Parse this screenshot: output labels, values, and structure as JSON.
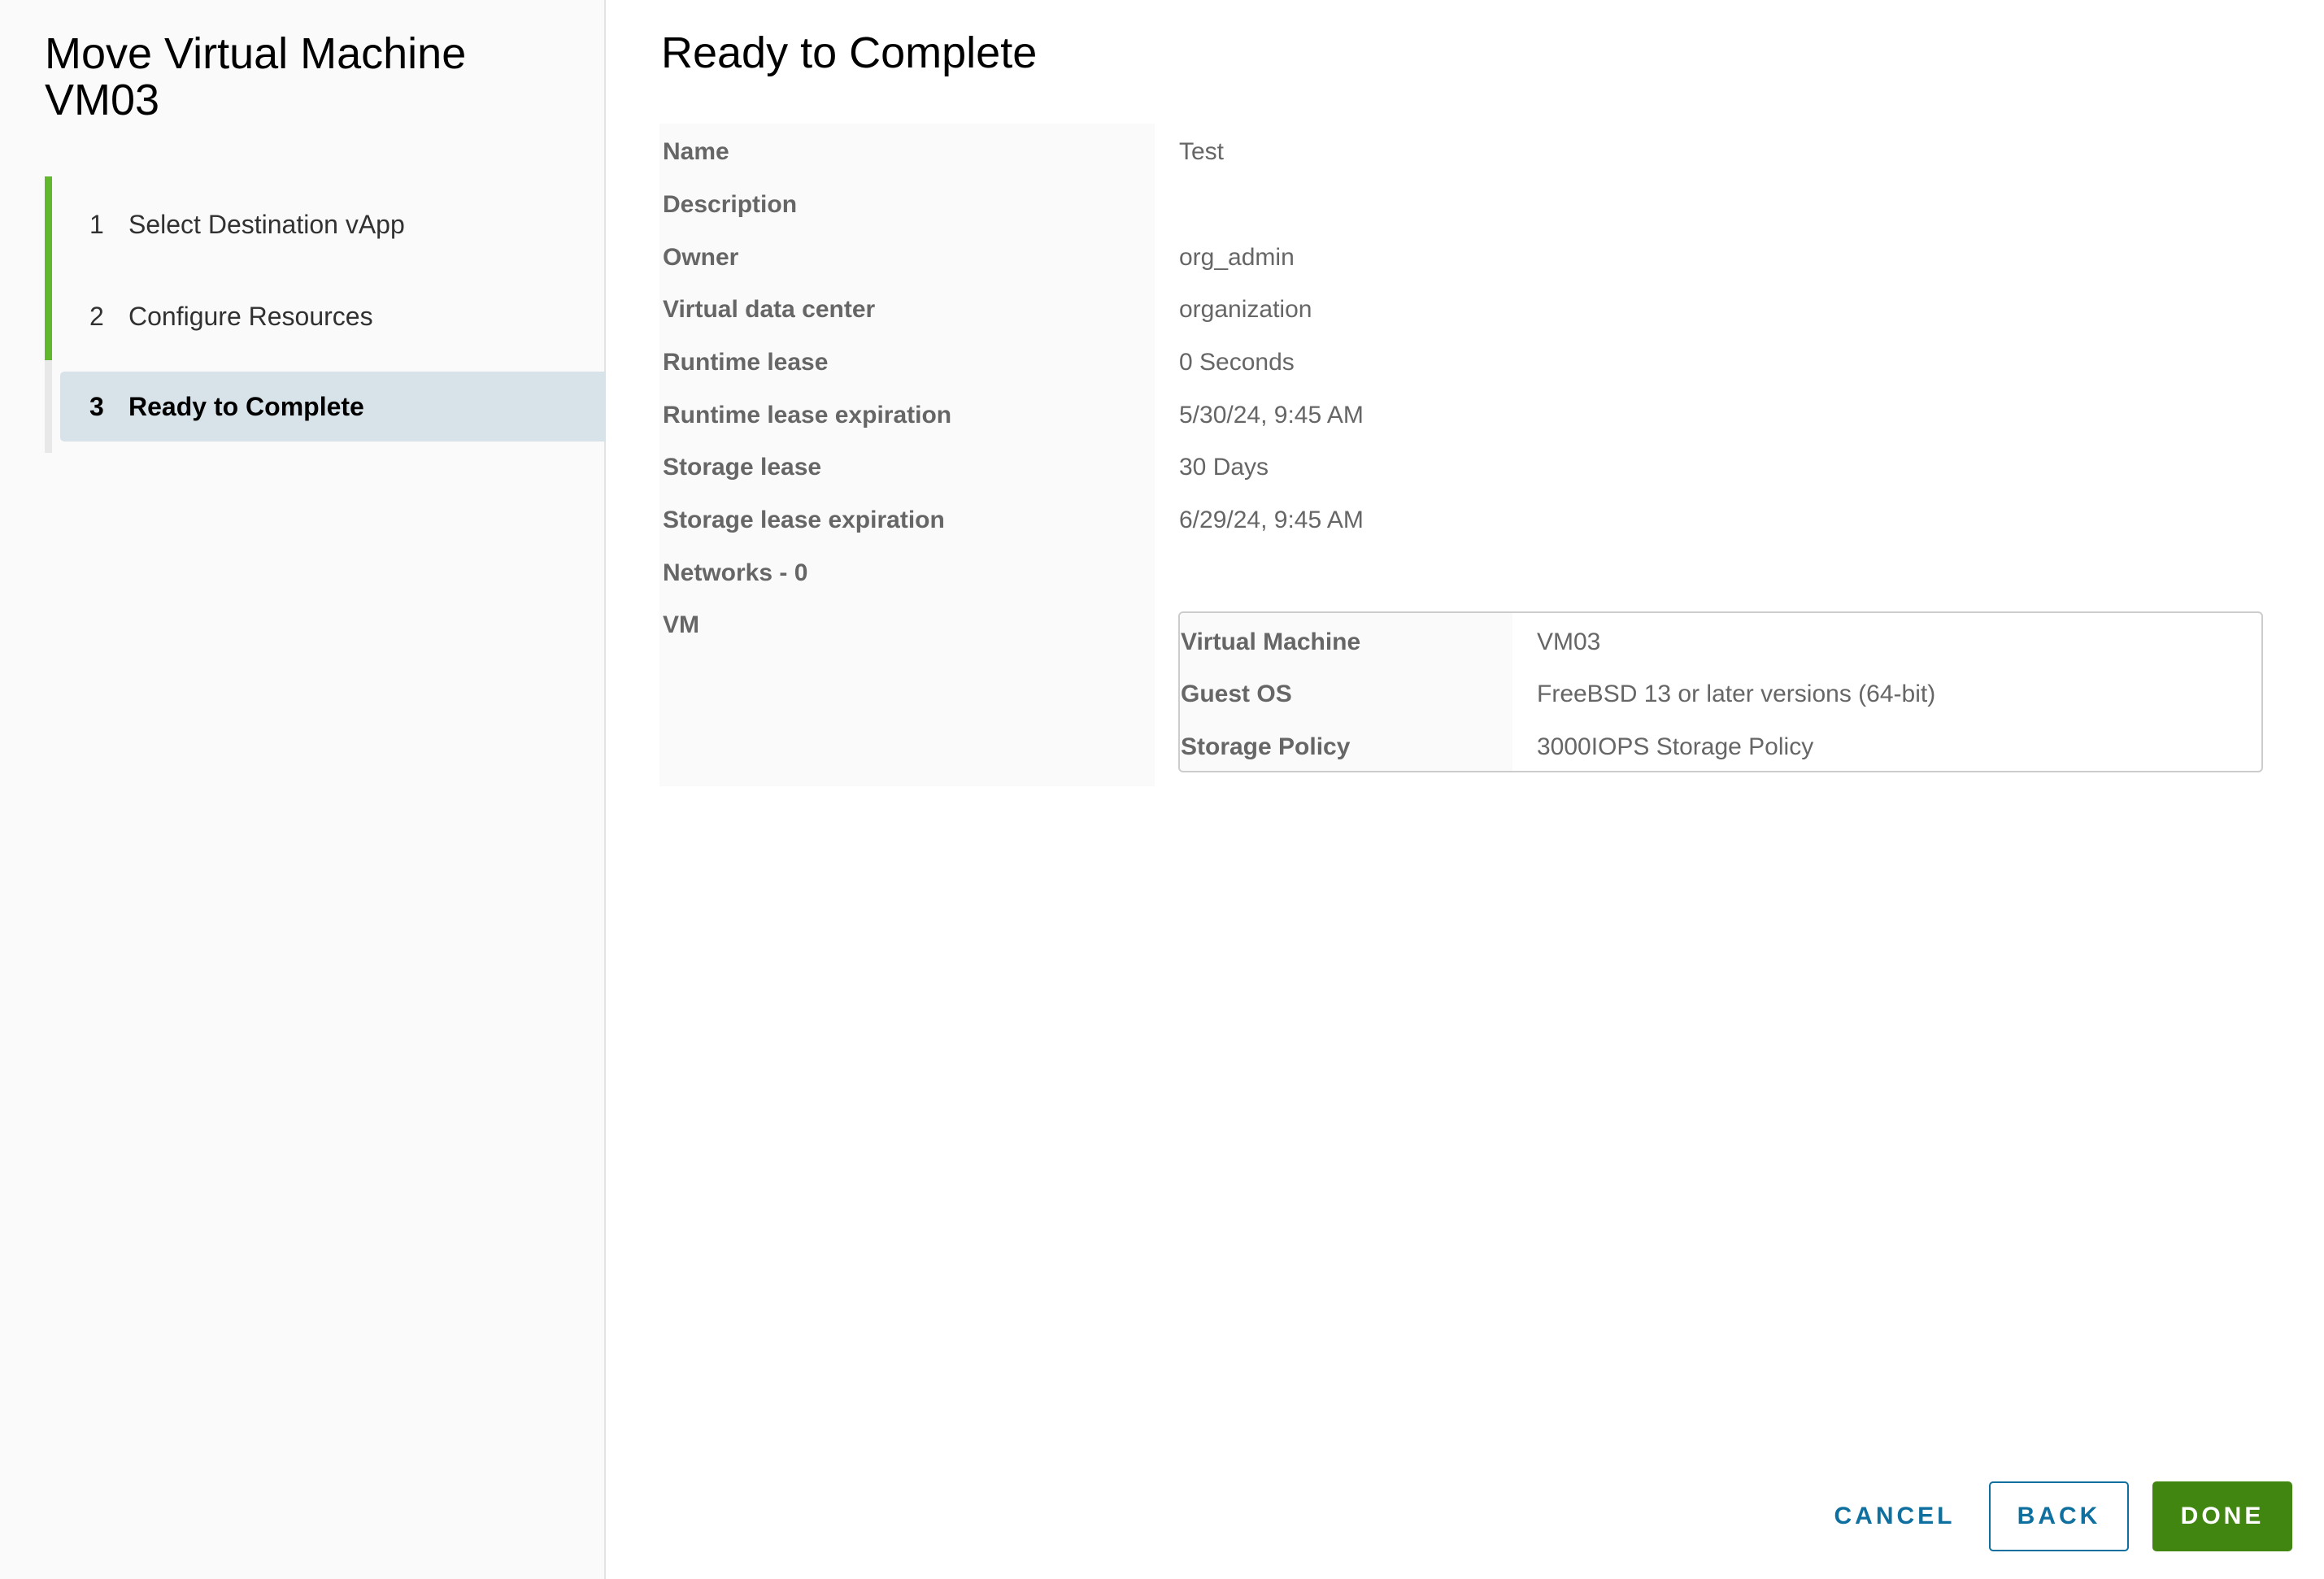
{
  "wizard": {
    "title": "Move Virtual Machine VM03",
    "steps": [
      {
        "number": "1",
        "label": "Select Destination vApp",
        "status": "completed"
      },
      {
        "number": "2",
        "label": "Configure Resources",
        "status": "completed"
      },
      {
        "number": "3",
        "label": "Ready to Complete",
        "status": "active"
      }
    ]
  },
  "colors": {
    "step_complete": "#62b82c",
    "step_active_bg": "#d8e3e9",
    "primary_link": "#0f6f9e",
    "done_button": "#428612"
  },
  "main": {
    "title": "Ready to Complete",
    "details": [
      {
        "label": "Name",
        "value": "Test"
      },
      {
        "label": "Description",
        "value": ""
      },
      {
        "label": "Owner",
        "value": "org_admin"
      },
      {
        "label": "Virtual data center",
        "value": "organization"
      },
      {
        "label": "Runtime lease",
        "value": "0 Seconds"
      },
      {
        "label": "Runtime lease expiration",
        "value": "5/30/24, 9:45 AM"
      },
      {
        "label": "Storage lease",
        "value": "30 Days"
      },
      {
        "label": "Storage lease expiration",
        "value": "6/29/24, 9:45 AM"
      },
      {
        "label": "Networks - 0",
        "value": ""
      },
      {
        "label": "VM",
        "value": ""
      }
    ],
    "vm_table": [
      {
        "label": "Virtual Machine",
        "value": "VM03"
      },
      {
        "label": "Guest OS",
        "value": "FreeBSD 13 or later versions (64-bit)"
      },
      {
        "label": "Storage Policy",
        "value": "3000IOPS Storage Policy"
      }
    ]
  },
  "footer": {
    "cancel_label": "CANCEL",
    "back_label": "BACK",
    "done_label": "DONE"
  }
}
